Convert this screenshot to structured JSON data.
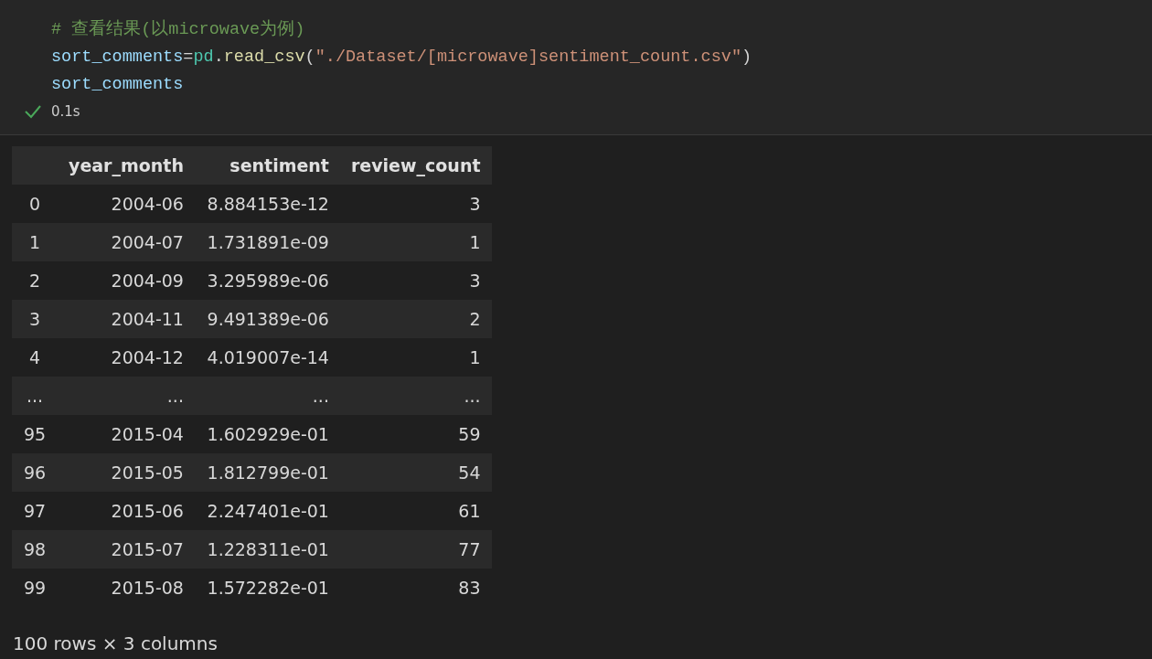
{
  "code_cell": {
    "lines": [
      [
        {
          "kind": "comment",
          "text": "# 查看结果(以microwave为例)"
        }
      ],
      [
        {
          "kind": "variable",
          "text": "sort_comments"
        },
        {
          "kind": "operator",
          "text": "="
        },
        {
          "kind": "module",
          "text": "pd"
        },
        {
          "kind": "plain",
          "text": "."
        },
        {
          "kind": "function",
          "text": "read_csv"
        },
        {
          "kind": "plain",
          "text": "("
        },
        {
          "kind": "string",
          "text": "\"./Dataset/[microwave]sentiment_count.csv\""
        },
        {
          "kind": "plain",
          "text": ")"
        }
      ],
      [
        {
          "kind": "variable",
          "text": "sort_comments"
        }
      ]
    ],
    "status": {
      "succeeded": true,
      "duration": "0.1s"
    }
  },
  "table": {
    "columns": [
      "",
      "year_month",
      "sentiment",
      "review_count"
    ],
    "rows": [
      [
        "0",
        "2004-06",
        "8.884153e-12",
        "3"
      ],
      [
        "1",
        "2004-07",
        "1.731891e-09",
        "1"
      ],
      [
        "2",
        "2004-09",
        "3.295989e-06",
        "3"
      ],
      [
        "3",
        "2004-11",
        "9.491389e-06",
        "2"
      ],
      [
        "4",
        "2004-12",
        "4.019007e-14",
        "1"
      ],
      [
        "...",
        "...",
        "...",
        "..."
      ],
      [
        "95",
        "2015-04",
        "1.602929e-01",
        "59"
      ],
      [
        "96",
        "2015-05",
        "1.812799e-01",
        "54"
      ],
      [
        "97",
        "2015-06",
        "2.247401e-01",
        "61"
      ],
      [
        "98",
        "2015-07",
        "1.228311e-01",
        "77"
      ],
      [
        "99",
        "2015-08",
        "1.572282e-01",
        "83"
      ]
    ]
  },
  "footer": "100 rows × 3 columns"
}
